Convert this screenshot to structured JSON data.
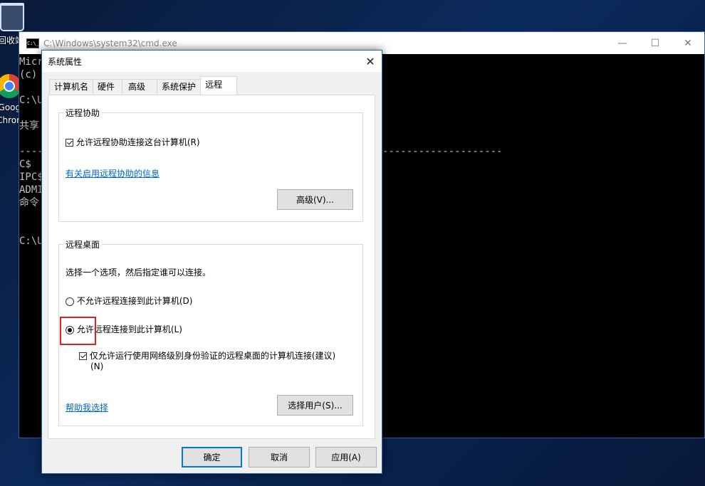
{
  "desktop": {
    "recycle_label": "回收站",
    "chrome_label_1": "Googl",
    "chrome_label_2": "Chrom"
  },
  "cmd": {
    "title": "C:\\Windows\\system32\\cmd.exe",
    "icon_text": "C:\\_",
    "lines": [
      "Micr",
      "(c)",
      "C:\\U",
      "共享",
      "----",
      "C$",
      "IPC$",
      "ADMI",
      "命令",
      "C:\\U"
    ],
    "dash_line_right": "--------------------",
    "minimize": "—",
    "maximize": "☐",
    "close": "✕"
  },
  "dialog": {
    "title": "系统属性",
    "close": "✕",
    "tabs": [
      "计算机名",
      "硬件",
      "高级",
      "系统保护",
      "远程"
    ],
    "remote_assist": {
      "group_title": "远程协助",
      "checkbox_label": "允许远程协助连接这台计算机(R)",
      "link": "有关启用远程协助的信息",
      "advanced_button": "高级(V)..."
    },
    "remote_desktop": {
      "group_title": "远程桌面",
      "instruction": "选择一个选项，然后指定谁可以连接。",
      "radio_deny": "不允许远程连接到此计算机(D)",
      "radio_allow": "允许远程连接到此计算机(L)",
      "nla_line1": "仅允许运行使用网络级别身份验证的远程桌面的计算机连接(建议)",
      "nla_line2": "(N)",
      "help_link": "帮助我选择",
      "select_users_button": "选择用户(S)..."
    },
    "buttons": {
      "ok": "确定",
      "cancel": "取消",
      "apply": "应用(A)"
    }
  }
}
